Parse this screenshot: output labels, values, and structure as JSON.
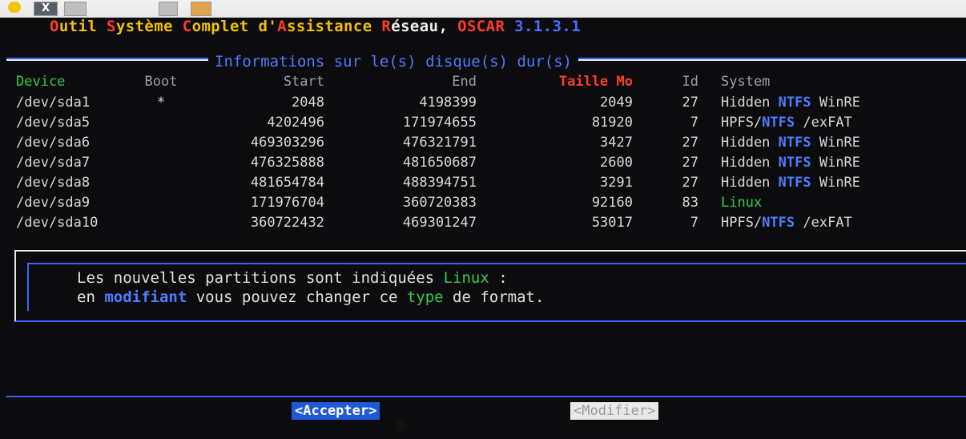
{
  "window": {
    "close_glyph": "X"
  },
  "title": {
    "parts": [
      {
        "t": "O",
        "c": "r"
      },
      {
        "t": "util ",
        "c": "y"
      },
      {
        "t": "S",
        "c": "r"
      },
      {
        "t": "ystème ",
        "c": "y"
      },
      {
        "t": "C",
        "c": "r"
      },
      {
        "t": "omplet d'",
        "c": "y"
      },
      {
        "t": "A",
        "c": "r"
      },
      {
        "t": "ssistance ",
        "c": "y"
      },
      {
        "t": "R",
        "c": "r"
      },
      {
        "t": "éseau, ",
        "c": "w"
      },
      {
        "t": "OSCAR ",
        "c": "r"
      },
      {
        "t": "3.1.3.1",
        "c": "b"
      }
    ]
  },
  "panel": {
    "title": "Informations sur le(s) disque(s) dur(s)",
    "headers": {
      "device": "Device",
      "boot": "Boot",
      "start": "Start",
      "end": "End",
      "size": "Taille Mo",
      "id": "Id",
      "system": "System"
    },
    "rows": [
      {
        "device": "/dev/sda1",
        "boot": "*",
        "start": "2048",
        "end": "4198399",
        "size": "2049",
        "id": "27",
        "system": [
          "Hidden ",
          "NTFS",
          " WinRE"
        ]
      },
      {
        "device": "/dev/sda5",
        "boot": "",
        "start": "4202496",
        "end": "171974655",
        "size": "81920",
        "id": "7",
        "system": [
          "HPFS/",
          "NTFS",
          " /exFAT"
        ]
      },
      {
        "device": "/dev/sda6",
        "boot": "",
        "start": "469303296",
        "end": "476321791",
        "size": "3427",
        "id": "27",
        "system": [
          "Hidden ",
          "NTFS",
          " WinRE"
        ]
      },
      {
        "device": "/dev/sda7",
        "boot": "",
        "start": "476325888",
        "end": "481650687",
        "size": "2600",
        "id": "27",
        "system": [
          "Hidden ",
          "NTFS",
          " WinRE"
        ]
      },
      {
        "device": "/dev/sda8",
        "boot": "",
        "start": "481654784",
        "end": "488394751",
        "size": "3291",
        "id": "27",
        "system": [
          "Hidden ",
          "NTFS",
          " WinRE"
        ]
      },
      {
        "device": "/dev/sda9",
        "boot": "",
        "start": "171976704",
        "end": "360720383",
        "size": "92160",
        "id": "83",
        "system": [
          "",
          "",
          "Linux"
        ],
        "linux": true
      },
      {
        "device": "/dev/sda10",
        "boot": "",
        "start": "360722432",
        "end": "469301247",
        "size": "53017",
        "id": "7",
        "system": [
          "HPFS/",
          "NTFS",
          " /exFAT"
        ]
      }
    ]
  },
  "message": {
    "line1": {
      "a": "Les nouvelles partitions sont indiquées ",
      "b": "Linux",
      "c": " :"
    },
    "line2": {
      "a": "en ",
      "b": "modifiant",
      "c": " vous pouvez changer ce ",
      "d": "type",
      "e": " de format."
    }
  },
  "buttons": {
    "accept": "<Accepter>",
    "modify": "<Modifier>"
  },
  "colors": {
    "bg": "#0c0c0f",
    "blue": "#3d63ff",
    "green": "#35c94a",
    "red": "#ff3b2b",
    "yellow": "#f0c000"
  }
}
